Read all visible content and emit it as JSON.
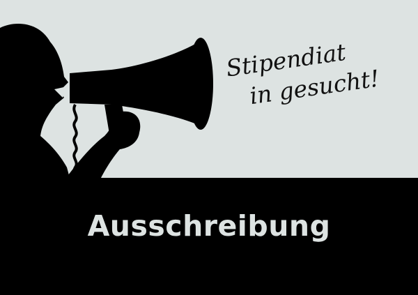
{
  "poster": {
    "headline_line1": "Stipendiat",
    "headline_line2": "in gesucht!",
    "title": "Ausschreibung",
    "illustration_icon": "megaphone-silhouette-icon",
    "colors": {
      "background": "#dde3e2",
      "silhouette": "#000000",
      "title_text": "#dde3e2",
      "headline_text": "#111111"
    }
  }
}
